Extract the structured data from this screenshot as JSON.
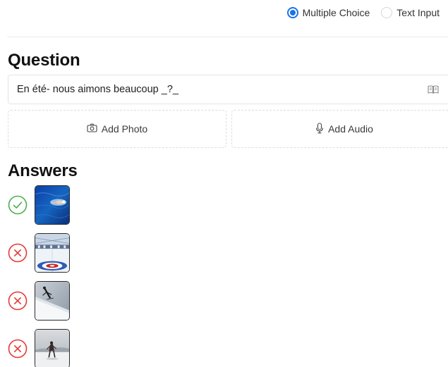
{
  "answer_type": {
    "options": [
      {
        "label": "Multiple Choice",
        "selected": true
      },
      {
        "label": "Text Input",
        "selected": false
      }
    ]
  },
  "question": {
    "heading": "Question",
    "text": "En été- nous aimons beaucoup _?_"
  },
  "media": {
    "photo_label": "Add Photo",
    "audio_label": "Add Audio"
  },
  "answers": {
    "heading": "Answers",
    "items": [
      {
        "status": "correct",
        "image": "swimmer-in-pool"
      },
      {
        "status": "incorrect",
        "image": "curling-rink"
      },
      {
        "status": "incorrect",
        "image": "skier-on-slope"
      },
      {
        "status": "incorrect",
        "image": "ice-skater"
      }
    ]
  },
  "colors": {
    "accent": "#1a73e8",
    "correct": "#4caf50",
    "incorrect": "#e53935"
  }
}
